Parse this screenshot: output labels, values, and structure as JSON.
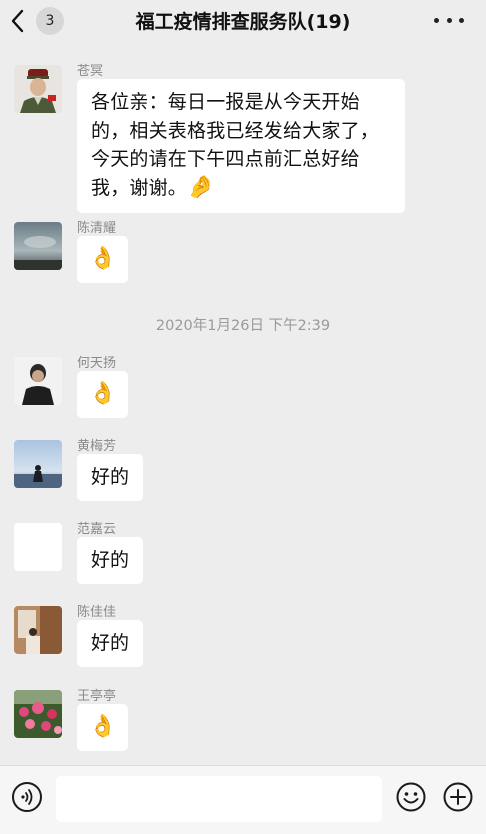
{
  "header": {
    "back_icon": "chevron-left-icon",
    "unread_count": "3",
    "title": "福工疫情排查服务队(19)",
    "more_icon": "ellipsis-icon"
  },
  "messages": [
    {
      "sender": "苍冥",
      "text": "各位亲：每日一报是从今天开始的，相关表格我已经发给大家了，今天的请在下午四点前汇总好给我，谢谢。",
      "emoji": "🤌",
      "avatar_icon": "soldier-avatar"
    },
    {
      "sender": "陈清耀",
      "emoji": "👌",
      "avatar_icon": "sky-landscape-avatar"
    },
    {
      "sender": "何天扬",
      "emoji": "👌",
      "avatar_icon": "person-portrait-avatar"
    },
    {
      "sender": "黄梅芳",
      "text": "好的",
      "avatar_icon": "beach-silhouette-avatar"
    },
    {
      "sender": "范嘉云",
      "text": "好的",
      "avatar_icon": "blank-avatar"
    },
    {
      "sender": "陈佳佳",
      "text": "好的",
      "avatar_icon": "wooden-room-avatar"
    },
    {
      "sender": "王亭亭",
      "emoji": "👌",
      "avatar_icon": "flower-field-avatar"
    }
  ],
  "timestamp": "2020年1月26日 下午2:39",
  "input_bar": {
    "voice_icon": "voice-icon",
    "input_value": "",
    "emoji_icon": "emoji-smile-icon",
    "plus_icon": "plus-icon"
  },
  "colors": {
    "background": "#ededed",
    "bubble": "#ffffff",
    "timestamp": "#9a9a9a"
  }
}
